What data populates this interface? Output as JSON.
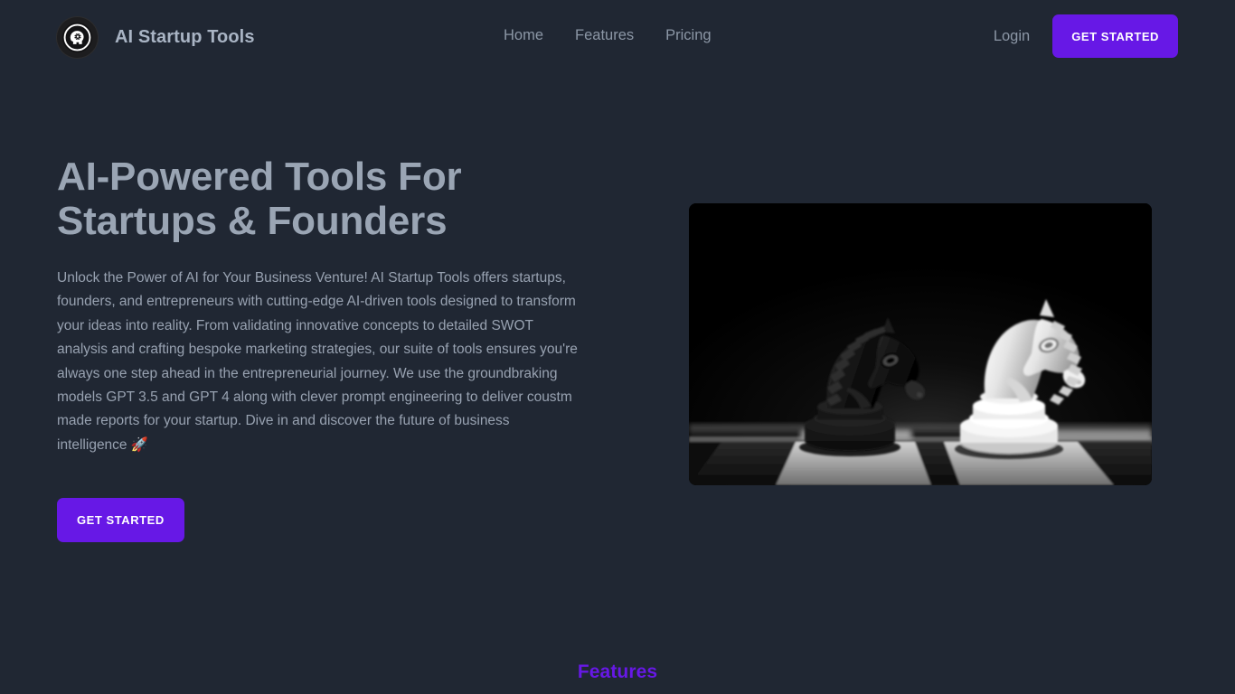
{
  "brand": {
    "name": "AI Startup Tools",
    "logo_icon": "brain-head-icon"
  },
  "nav": {
    "items": [
      {
        "label": "Home"
      },
      {
        "label": "Features"
      },
      {
        "label": "Pricing"
      }
    ],
    "login_label": "Login",
    "cta_label": "GET STARTED"
  },
  "hero": {
    "title": "AI-Powered Tools For Startups & Founders",
    "title_line1": "AI-Powered Tools For",
    "title_line2": "Startups & Founders",
    "paragraph": "Unlock the Power of AI for Your Business Venture! AI Startup Tools offers startups, founders, and entrepreneurs with cutting-edge AI-driven tools designed to transform your ideas into reality. From validating innovative concepts to detailed SWOT analysis and crafting bespoke marketing strategies, our suite of tools ensures you're always one step ahead in the entrepreneurial journey. We use the groundbraking models GPT 3.5 and GPT 4 along with clever prompt engineering to deliver coustm made reports for your startup. Dive in and discover the future of business intelligence 🚀",
    "cta_label": "GET STARTED",
    "image_alt": "chess-knights-photo"
  },
  "features": {
    "heading": "Features"
  },
  "colors": {
    "page_background": "#202733",
    "accent_purple": "#6718e6",
    "heading_text": "#9aa5b4",
    "body_text": "#98a2b1",
    "nav_text": "#8c97a6"
  }
}
